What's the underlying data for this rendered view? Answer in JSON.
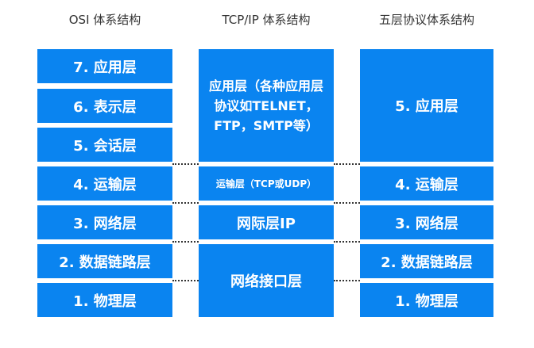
{
  "headers": {
    "osi": "OSI 体系结构",
    "tcpip": "TCP/IP 体系结构",
    "five": "五层协议体系结构"
  },
  "osi_layers": {
    "application": "7. 应用层",
    "presentation": "6. 表示层",
    "session": "5. 会话层",
    "transport": "4. 运输层",
    "network": "3. 网络层",
    "datalink": "2. 数据链路层",
    "physical": "1. 物理层"
  },
  "tcpip_layers": {
    "application": "应用层（各种应用层协议如TELNET，FTP，SMTP等）",
    "transport": "运输层（TCP或UDP）",
    "internet": "网际层IP",
    "network_interface": "网络接口层"
  },
  "five_layers": {
    "application": "5. 应用层",
    "transport": "4. 运输层",
    "network": "3. 网络层",
    "datalink": "2. 数据链路层",
    "physical": "1. 物理层"
  },
  "colors": {
    "box": "#0a84f0",
    "box_text": "#ffffff",
    "header_text": "#333333",
    "connector": "#333333"
  }
}
